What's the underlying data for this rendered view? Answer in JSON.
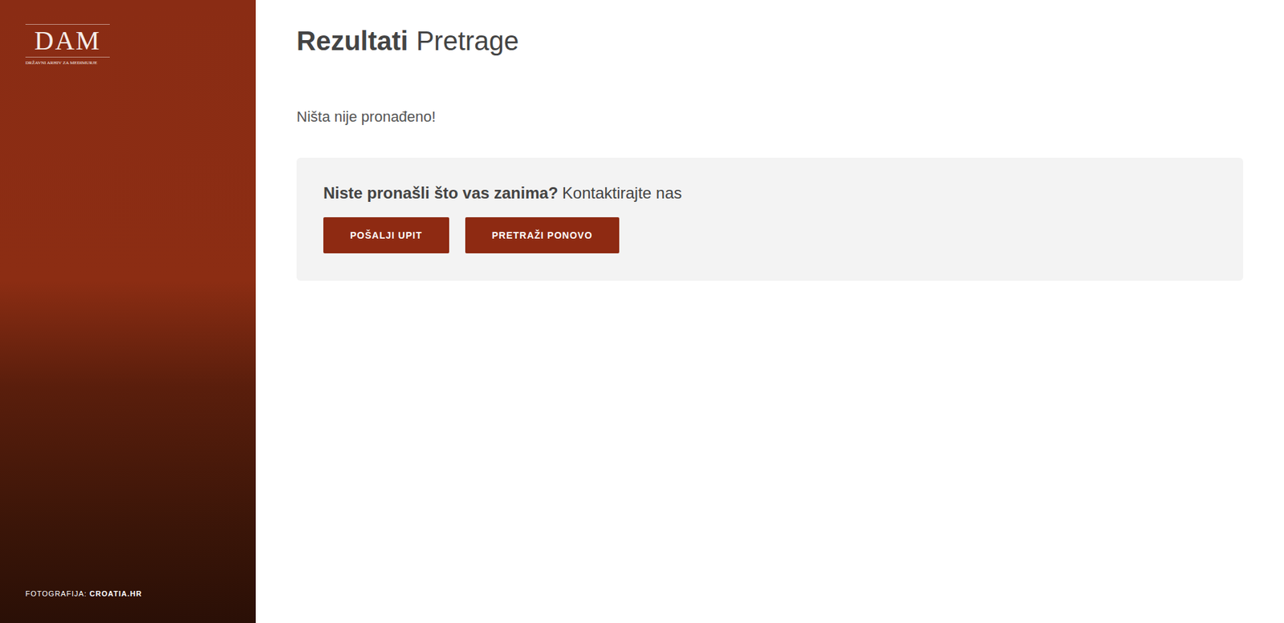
{
  "sidebar": {
    "logo": {
      "mark": "DAM",
      "caption": "DRŽAVNI ARHIV ZA MEĐIMURJE"
    },
    "credit": {
      "label": "FOTOGRAFIJA:",
      "source": "CROATIA.HR"
    }
  },
  "page": {
    "title": {
      "bold": "Rezultati",
      "light": "Pretrage"
    },
    "message": "Ništa nije pronađeno!"
  },
  "contact_box": {
    "question": "Niste pronašli što vas zanima?",
    "prompt": "Kontaktirajte nas",
    "buttons": [
      "POŠALJI UPIT",
      "PRETRAŽI PONOVO"
    ]
  }
}
